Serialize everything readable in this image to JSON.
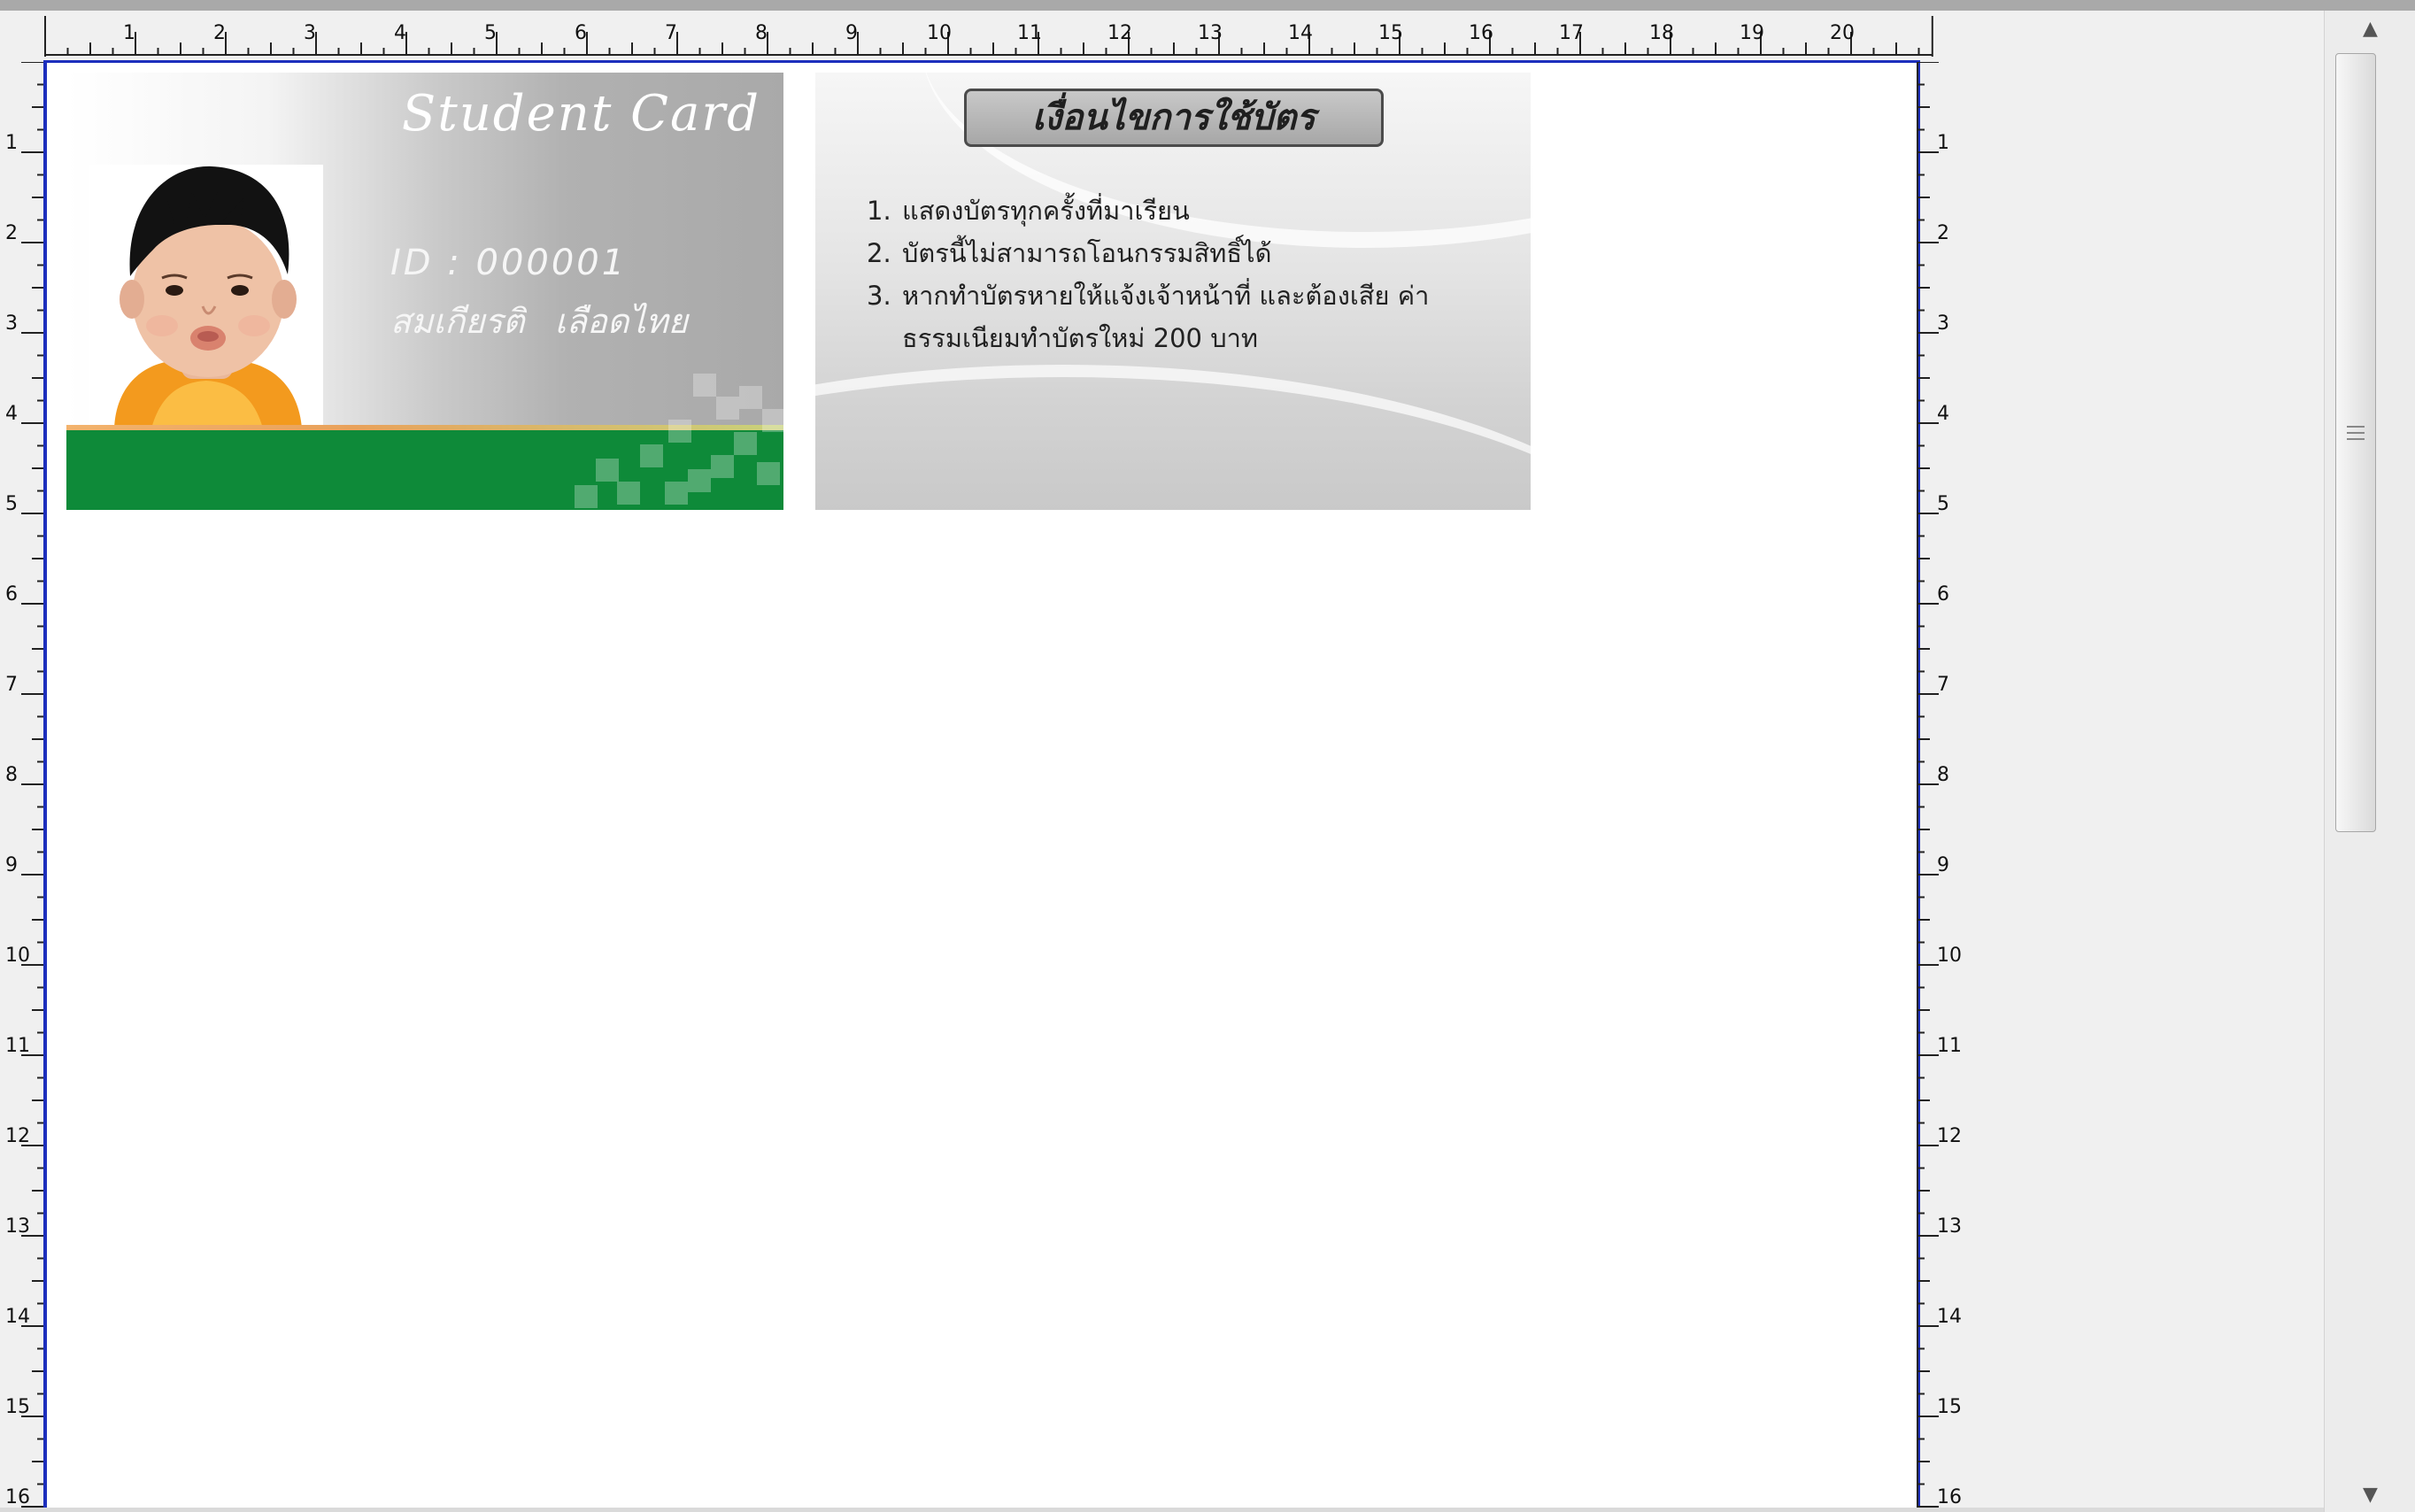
{
  "ruler": {
    "horizontal_labels": [
      "1",
      "2",
      "3",
      "4",
      "5",
      "6",
      "7",
      "8",
      "9",
      "10",
      "11",
      "12",
      "13",
      "14",
      "15",
      "16",
      "17",
      "18",
      "19",
      "20"
    ],
    "vertical_labels": [
      "1",
      "2",
      "3",
      "4",
      "5",
      "6",
      "7",
      "8",
      "9",
      "10",
      "11",
      "12",
      "13",
      "14",
      "15",
      "16"
    ]
  },
  "card_front": {
    "title": "Student Card",
    "id_text": "ID : 000001",
    "name_text": "สมเกียรติ  เลือดไทย"
  },
  "card_back": {
    "title": "เงื่อนไขการใช้บัตร",
    "rules": [
      {
        "num": "1.",
        "text": "แสดงบัตรทุกครั้งที่มาเรียน"
      },
      {
        "num": "2.",
        "text": "บัตรนี้ไม่สามารถโอนกรรมสิทธิ์ได้"
      },
      {
        "num": "3.",
        "text": "หากทำบัตรหายให้แจ้งเจ้าหน้าที่ และต้องเสีย ค่าธรรมเนียมทำบัตรใหม่ 200 บาท"
      }
    ]
  },
  "colors": {
    "accent_green": "#0e8a39",
    "page_border": "#1d2fbd"
  },
  "icons": {
    "scroll_up": "▲",
    "scroll_down": "▼"
  }
}
